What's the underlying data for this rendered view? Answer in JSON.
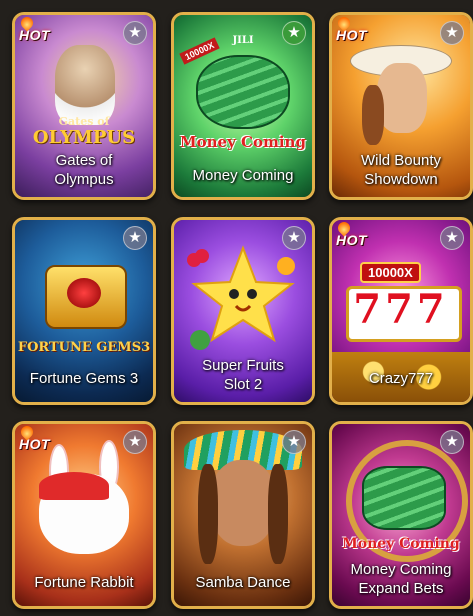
{
  "games": [
    {
      "title": "Gates of\nOlympus",
      "hot": true,
      "fav": false,
      "logo": "OLYMPUS",
      "sublogo": "Gates of"
    },
    {
      "title": "Money Coming",
      "hot": false,
      "fav": true,
      "logo": "Money Coming",
      "sublogo": "JILI",
      "badge": "10000X"
    },
    {
      "title": "Wild Bounty\nShowdown",
      "hot": true,
      "fav": false
    },
    {
      "title": "Fortune Gems 3",
      "hot": false,
      "fav": false,
      "logo": "FORTUNE GEMS3"
    },
    {
      "title": "Super Fruits\nSlot 2",
      "hot": false,
      "fav": false
    },
    {
      "title": "Crazy777",
      "hot": true,
      "fav": false,
      "logo": "777",
      "badge": "10000X"
    },
    {
      "title": "Fortune Rabbit",
      "hot": true,
      "fav": false
    },
    {
      "title": "Samba Dance",
      "hot": false,
      "fav": false
    },
    {
      "title": "Money Coming\nExpand Bets",
      "hot": false,
      "fav": false,
      "logo": "Money Coming"
    }
  ],
  "labels": {
    "hot": "HOT",
    "star": "★"
  }
}
